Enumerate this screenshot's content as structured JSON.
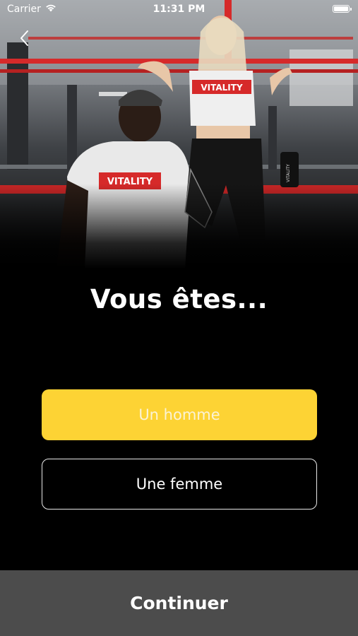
{
  "status_bar": {
    "carrier": "Carrier",
    "time": "11:31 PM",
    "wifi_icon": "wifi-icon",
    "battery_icon": "battery-icon"
  },
  "navigation": {
    "back_icon": "chevron-left-icon"
  },
  "hero": {
    "shirt_brand_left": "VITALITY",
    "shirt_brand_right": "VITALITY",
    "bottle_brand": "VITALITY"
  },
  "title": "Vous êtes...",
  "choices": [
    {
      "label": "Un homme",
      "selected": true
    },
    {
      "label": "Une femme",
      "selected": false
    }
  ],
  "continue_label": "Continuer",
  "colors": {
    "accent": "#fdd334",
    "background": "#000000",
    "continue_bar": "#4c4c4c",
    "hero_rail": "#d62a2a"
  }
}
